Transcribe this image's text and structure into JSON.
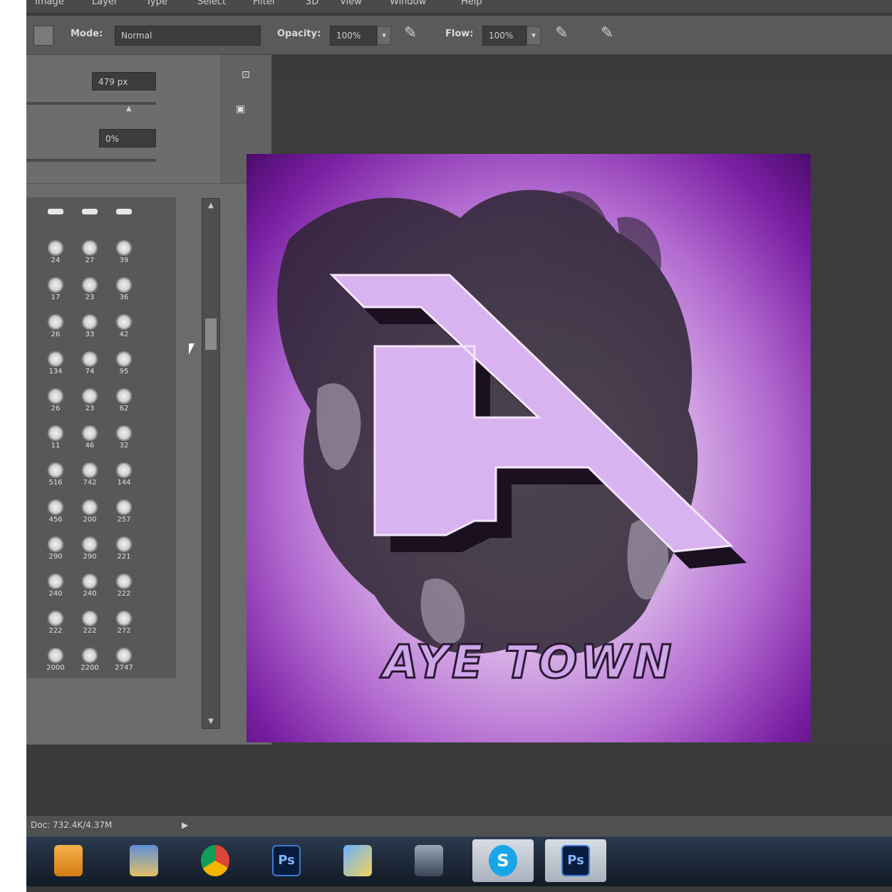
{
  "menu": [
    "Image",
    "Layer",
    "Type",
    "Select",
    "Filter",
    "3D",
    "View",
    "Window",
    "Help"
  ],
  "options": {
    "mode_label": "Mode:",
    "mode_value": "Normal",
    "opacity_label": "Opacity:",
    "opacity_value": "100%",
    "flow_label": "Flow:",
    "flow_value": "100%"
  },
  "brush_panel": {
    "size_value": "479 px",
    "hardness_value": "0%"
  },
  "brushes": [
    "24",
    "27",
    "39",
    "17",
    "23",
    "36",
    "26",
    "33",
    "42",
    "134",
    "74",
    "95",
    "26",
    "23",
    "62",
    "11",
    "46",
    "32",
    "516",
    "742",
    "144",
    "456",
    "200",
    "257",
    "290",
    "290",
    "221",
    "240",
    "240",
    "222",
    "222",
    "222",
    "272",
    "2000",
    "2200",
    "2747"
  ],
  "artwork": {
    "title": "AYE TOWN",
    "colors": {
      "accent": "#9b2fd6",
      "letter": "#d9b3ef",
      "shadow": "#2a1a33"
    }
  },
  "status": {
    "doc_info": "Doc: 732.4K/4.37M"
  },
  "taskbar": [
    {
      "name": "media-player-icon"
    },
    {
      "name": "file-manager-icon"
    },
    {
      "name": "chrome-icon"
    },
    {
      "name": "photoshop-icon",
      "label": "Ps"
    },
    {
      "name": "paint-icon"
    },
    {
      "name": "camera-icon"
    },
    {
      "name": "skype-icon",
      "label": "S"
    },
    {
      "name": "photoshop-active-icon",
      "label": "Ps"
    }
  ]
}
